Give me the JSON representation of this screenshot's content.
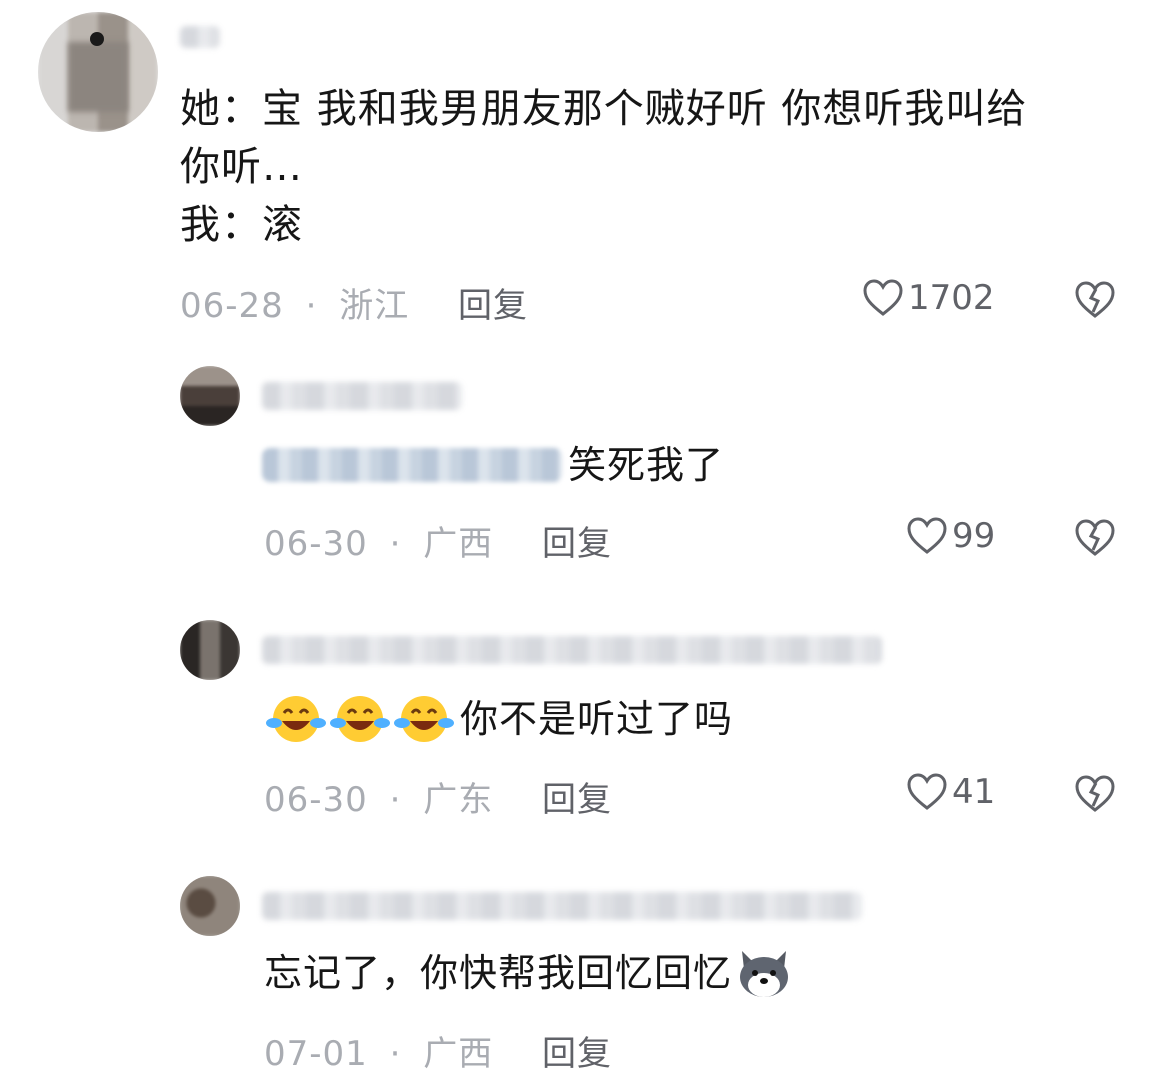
{
  "comments": [
    {
      "text_lines": [
        "她：宝 我和我男朋友那个贼好听 你想听我叫给",
        "你听…",
        "我：滚"
      ],
      "date": "06-28",
      "location": "浙江",
      "reply_label": "回复",
      "likes": "1702"
    },
    {
      "text": "笑死我了",
      "date": "06-30",
      "location": "广西",
      "reply_label": "回复",
      "likes": "99"
    },
    {
      "emoji": [
        "crying-laughing-emoji",
        "crying-laughing-emoji",
        "crying-laughing-emoji"
      ],
      "text": "你不是听过了吗",
      "date": "06-30",
      "location": "广东",
      "reply_label": "回复",
      "likes": "41"
    },
    {
      "text": "忘记了，你快帮我回忆回忆",
      "emoji": [
        "husky-dog-emoji"
      ],
      "date": "07-01",
      "location": "广西",
      "reply_label": "回复"
    }
  ],
  "separator": "·",
  "colors": {
    "text": "#161616",
    "meta": "#a9acb2",
    "action": "#606268"
  }
}
